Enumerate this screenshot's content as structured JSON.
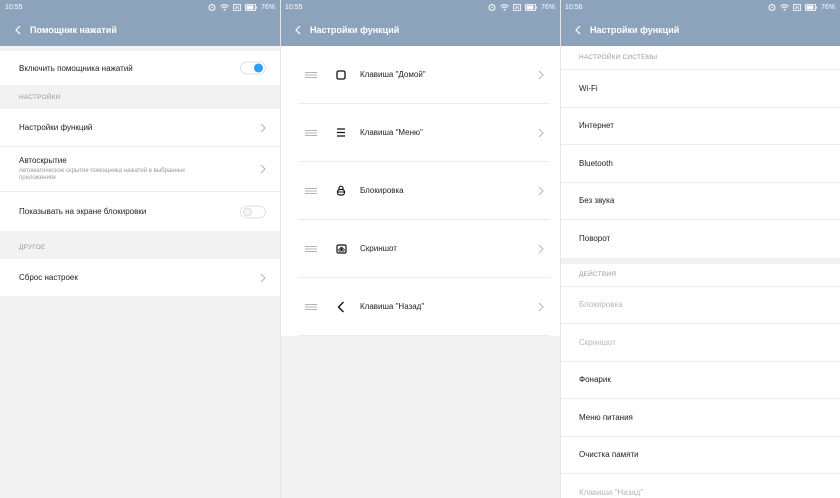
{
  "screens": [
    {
      "status": {
        "time": "10:55",
        "battery": "76%"
      },
      "title": "Помощник нажатий",
      "toggle_row": {
        "label": "Включить помощника нажатий",
        "on": true
      },
      "section_settings": "НАСТРОЙКИ",
      "items": [
        {
          "label": "Настройки функций"
        },
        {
          "label": "Автоскрытие",
          "sub": "Автоматическое скрытие помощника нажатий в выбранных приложениях"
        }
      ],
      "lockscreen_row": {
        "label": "Показывать на экране блокировки",
        "on": false
      },
      "section_other": "ДРУГОЕ",
      "reset_label": "Сброс настроек"
    },
    {
      "status": {
        "time": "10:55",
        "battery": "76%"
      },
      "title": "Настройки функций",
      "functions": [
        {
          "label": "Клавиша \"Домой\"",
          "icon": "home-square-icon"
        },
        {
          "label": "Клавиша \"Меню\"",
          "icon": "menu-icon"
        },
        {
          "label": "Блокировка",
          "icon": "lock-icon"
        },
        {
          "label": "Скриншот",
          "icon": "screenshot-icon"
        },
        {
          "label": "Клавиша \"Назад\"",
          "icon": "back-arrow-icon"
        }
      ]
    },
    {
      "status": {
        "time": "10:56",
        "battery": "76%"
      },
      "title": "Настройки функций",
      "section_system": "НАСТРОЙКИ СИСТЕМЫ",
      "system_items": [
        "Wi-Fi",
        "Интернет",
        "Bluetooth",
        "Без звука",
        "Поворот"
      ],
      "section_actions": "ДЕЙСТВИЯ",
      "action_items": [
        {
          "label": "Блокировка",
          "disabled": true
        },
        {
          "label": "Скриншот",
          "disabled": true
        },
        {
          "label": "Фонарик",
          "disabled": false
        },
        {
          "label": "Меню питания",
          "disabled": false
        },
        {
          "label": "Очистка памяти",
          "disabled": false
        },
        {
          "label": "Клавиша \"Назад\"",
          "disabled": true
        }
      ]
    }
  ],
  "colors": {
    "header": "#8da2bb",
    "toggle_on": "#2f9ef4",
    "section_text": "#9a9a9a"
  }
}
